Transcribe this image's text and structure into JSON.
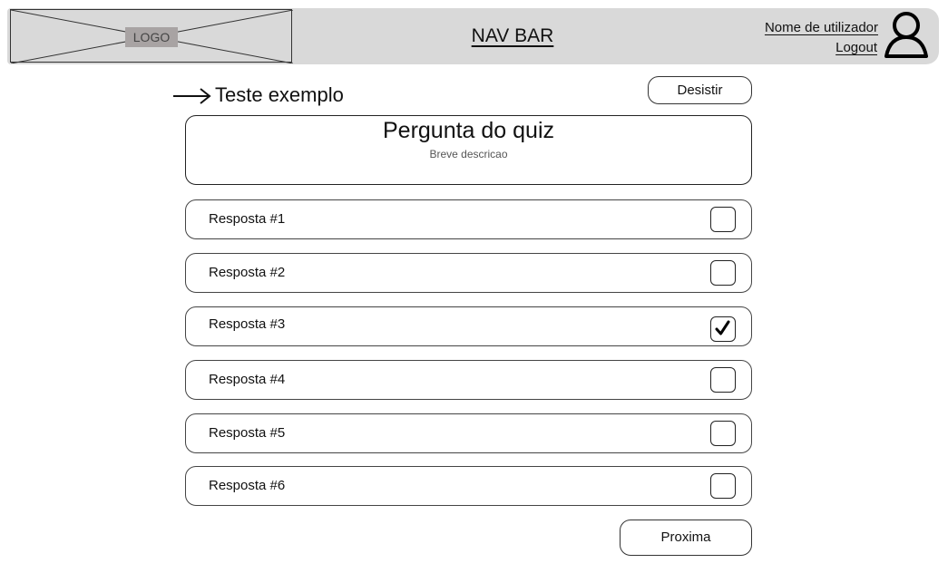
{
  "navbar": {
    "logo_label": "LOGO",
    "title": "NAV BAR",
    "user_name": "Nome de utilizador",
    "logout_label": "Logout",
    "background": "#d9d9d9"
  },
  "header": {
    "title": "Teste exemplo",
    "quit_label": "Desistir"
  },
  "question": {
    "title": "Pergunta do quiz",
    "description": "Breve descricao"
  },
  "answers": [
    {
      "label": "Resposta #1",
      "checked": false
    },
    {
      "label": "Resposta #2",
      "checked": false
    },
    {
      "label": "Resposta #3",
      "checked": true
    },
    {
      "label": "Resposta #4",
      "checked": false
    },
    {
      "label": "Resposta #5",
      "checked": false
    },
    {
      "label": "Resposta #6",
      "checked": false
    }
  ],
  "footer": {
    "next_label": "Proxima"
  }
}
